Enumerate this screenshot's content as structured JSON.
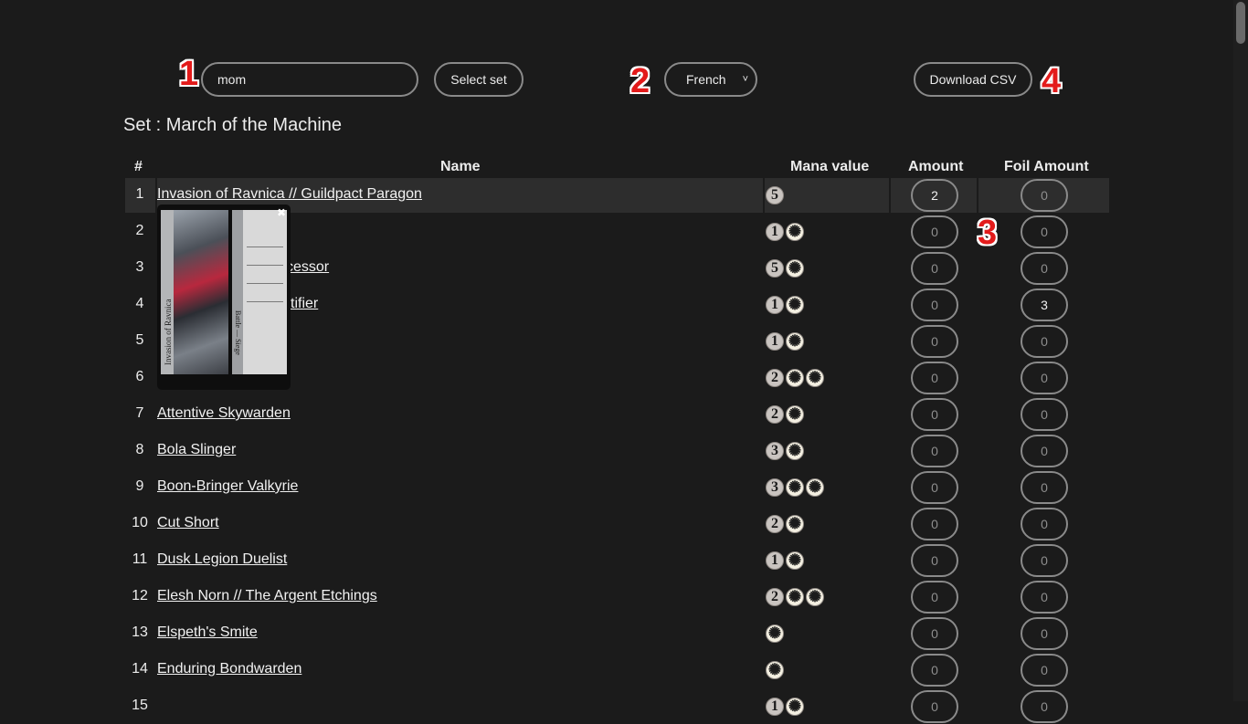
{
  "toolbar": {
    "search_value": "mom",
    "search_placeholder": "",
    "select_set_label": "Select set",
    "language_value": "French",
    "download_label": "Download CSV"
  },
  "annotations": {
    "step1": "1",
    "step2": "2",
    "step3": "3",
    "step4": "4"
  },
  "set_title": "Set : March of the Machine",
  "table": {
    "headers": {
      "num": "#",
      "name": "Name",
      "mana": "Mana value",
      "amount": "Amount",
      "foil": "Foil Amount"
    },
    "rows": [
      {
        "num": "1",
        "name": "Invasion of Ravnica // Guildpact Paragon",
        "mana": [
          "5"
        ],
        "amount": "2",
        "foil": "0"
      },
      {
        "num": "2",
        "name": "",
        "mana": [
          "1",
          "W"
        ],
        "amount": "0",
        "foil": "0"
      },
      {
        "num": "3",
        "name": "cessor",
        "mana": [
          "5",
          "W"
        ],
        "amount": "0",
        "foil": "0"
      },
      {
        "num": "4",
        "name": "tifier",
        "mana": [
          "1",
          "W"
        ],
        "amount": "0",
        "foil": "3"
      },
      {
        "num": "5",
        "name": "",
        "mana": [
          "1",
          "W"
        ],
        "amount": "0",
        "foil": "0"
      },
      {
        "num": "6",
        "name": "",
        "mana": [
          "2",
          "W",
          "W"
        ],
        "amount": "0",
        "foil": "0"
      },
      {
        "num": "7",
        "name": "Attentive Skywarden",
        "mana": [
          "2",
          "W"
        ],
        "amount": "0",
        "foil": "0"
      },
      {
        "num": "8",
        "name": "Bola Slinger",
        "mana": [
          "3",
          "W"
        ],
        "amount": "0",
        "foil": "0"
      },
      {
        "num": "9",
        "name": "Boon-Bringer Valkyrie",
        "mana": [
          "3",
          "W",
          "W"
        ],
        "amount": "0",
        "foil": "0"
      },
      {
        "num": "10",
        "name": "Cut Short",
        "mana": [
          "2",
          "W"
        ],
        "amount": "0",
        "foil": "0"
      },
      {
        "num": "11",
        "name": "Dusk Legion Duelist",
        "mana": [
          "1",
          "W"
        ],
        "amount": "0",
        "foil": "0"
      },
      {
        "num": "12",
        "name": "Elesh Norn // The Argent Etchings",
        "mana": [
          "2",
          "W",
          "W"
        ],
        "amount": "0",
        "foil": "0"
      },
      {
        "num": "13",
        "name": "Elspeth's Smite",
        "mana": [
          "W"
        ],
        "amount": "0",
        "foil": "0"
      },
      {
        "num": "14",
        "name": "Enduring Bondwarden",
        "mana": [
          "W"
        ],
        "amount": "0",
        "foil": "0"
      },
      {
        "num": "15",
        "name": "",
        "mana": [
          "1",
          "W"
        ],
        "amount": "0",
        "foil": "0"
      }
    ]
  },
  "card_preview": {
    "title": "Invasion of Ravnica",
    "type_line": "Battle — Siege"
  },
  "colors": {
    "background": "#1b1b1b",
    "highlight_row": "#2d2d2d",
    "annotation": "#e31b1b"
  }
}
